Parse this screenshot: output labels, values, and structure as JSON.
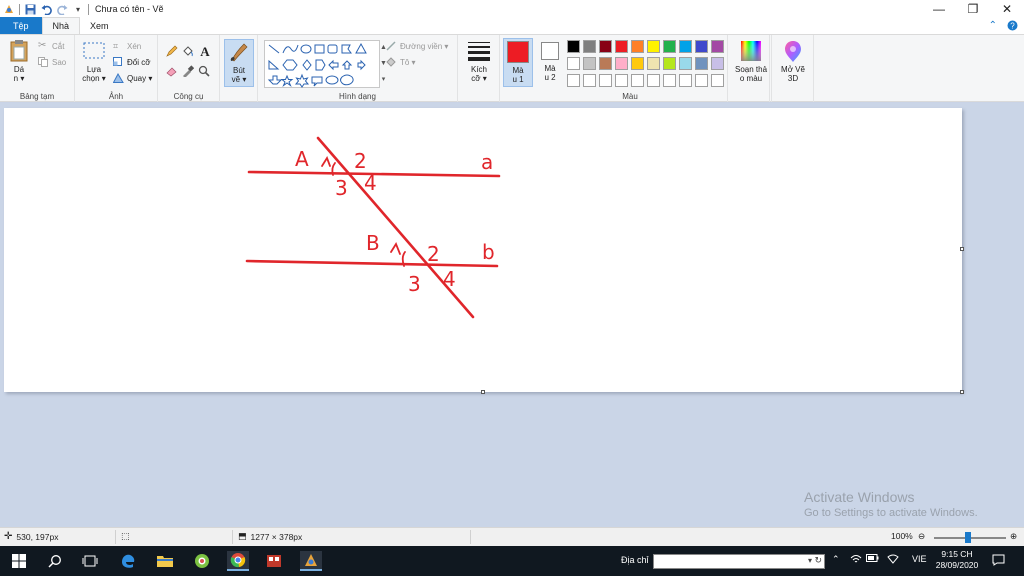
{
  "window": {
    "title": "Chưa có tên - Vẽ",
    "controls": [
      "—",
      "❐",
      "✕"
    ]
  },
  "tabs": [
    {
      "label": "Tệp",
      "active": false
    },
    {
      "label": "Nhà",
      "active": true
    },
    {
      "label": "Xem",
      "active": false
    }
  ],
  "ribbon": {
    "clipboard": {
      "group_label": "Bảng tạm",
      "paste_label_1": "Dá",
      "paste_label_2": "n ▾",
      "cut": "Cắt",
      "copy": "Sao"
    },
    "image": {
      "group_label": "Ảnh",
      "select_label_1": "Lựa",
      "select_label_2": "chọn ▾",
      "crop": "Xén",
      "resize": "Đổi cỡ",
      "rotate": "Quay ▾"
    },
    "tools": {
      "group_label": "Công cụ",
      "brush_label_1": "Bút",
      "brush_label_2": "vẽ ▾"
    },
    "shapes": {
      "group_label": "Hình dạng",
      "outline": "Đường viền ▾",
      "fill": "Tô ▾"
    },
    "size": {
      "label_1": "Kích",
      "label_2": "cỡ ▾"
    },
    "colors": {
      "group_label": "Màu",
      "color1_label_1": "Mà",
      "color1_label_2": "u 1",
      "color2_label_1": "Mà",
      "color2_label_2": "u 2",
      "color1": "#ed1c24",
      "color2": "#ffffff",
      "palette_row1": [
        "#000000",
        "#7f7f7f",
        "#880015",
        "#ed1c24",
        "#ff7f27",
        "#fff200",
        "#22b14c",
        "#00a2e8",
        "#3f48cc",
        "#a349a4"
      ],
      "palette_row2": [
        "#ffffff",
        "#c3c3c3",
        "#b97a57",
        "#ffaec9",
        "#ffc90e",
        "#efe4b0",
        "#b5e61d",
        "#99d9ea",
        "#7092be",
        "#c8bfe7"
      ],
      "edit_label_1": "Soạn thả",
      "edit_label_2": "o màu",
      "paint3d_label_1": "Mở Vẽ",
      "paint3d_label_2": "3D"
    }
  },
  "drawing": {
    "labels": {
      "A": "A",
      "a_angle1": "1",
      "a2": "2",
      "a3": "3",
      "a4": "4",
      "line_a": "a",
      "B": "B",
      "b_angle1": "1",
      "b2": "2",
      "b3": "3",
      "b4": "4",
      "line_b": "b"
    },
    "stroke_color": "#e0262b"
  },
  "watermark": {
    "line1": "Activate Windows",
    "line2": "Go to Settings to activate Windows."
  },
  "statusbar": {
    "cursor_pos": "530, 197px",
    "canvas_size": "1277 × 378px",
    "zoom": "100%"
  },
  "taskbar": {
    "address_label": "Địa chỉ",
    "lang": "VIE",
    "time": "9:15 CH",
    "date": "28/09/2020"
  }
}
